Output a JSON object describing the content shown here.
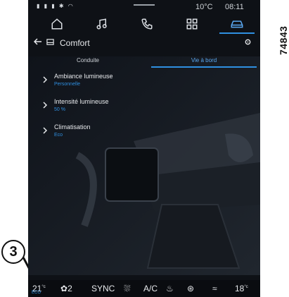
{
  "figure_id": "74843",
  "callout_number": "3",
  "status": {
    "outside_temp": "10°C",
    "time": "08:11"
  },
  "nav": {
    "items": [
      "home-icon",
      "music-icon",
      "phone-icon",
      "apps-icon",
      "vehicle-icon"
    ],
    "active_index": 4
  },
  "header": {
    "title": "Comfort"
  },
  "tabs": [
    {
      "label": "Conduite",
      "active": false
    },
    {
      "label": "Vie à bord",
      "active": true
    }
  ],
  "menu": {
    "items": [
      {
        "title": "Ambiance lumineuse",
        "subtitle": "Personnelle"
      },
      {
        "title": "Intensité lumineuse",
        "subtitle": "50 %"
      },
      {
        "title": "Climatisation",
        "subtitle": "Eco"
      }
    ]
  },
  "climate_bar": {
    "left_temp": "21",
    "left_temp_unit": "°c",
    "eco_label": "ECO",
    "fan_level": "2",
    "sync": "SYNC",
    "ac": "A/C",
    "right_temp": "18",
    "right_temp_unit": "°c"
  },
  "colors": {
    "accent": "#2f8fe0",
    "background": "#0e1116"
  }
}
